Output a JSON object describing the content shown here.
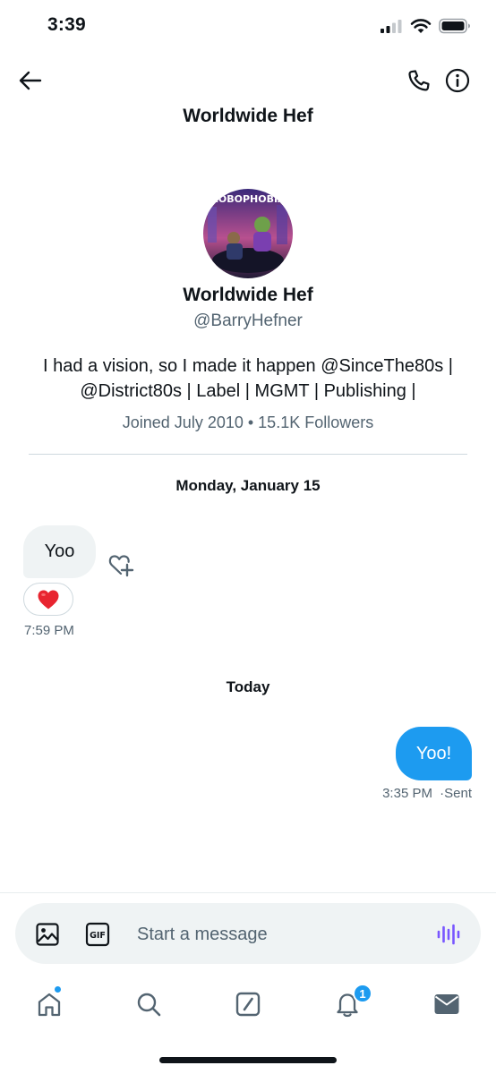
{
  "status_bar": {
    "time": "3:39"
  },
  "header": {
    "title": "Worldwide Hef"
  },
  "profile": {
    "avatar_text": "ROBOPHOBIA",
    "name": "Worldwide Hef",
    "handle": "@BarryHefner",
    "bio_line1": "I had a vision, so I made it happen @SinceThe80s |",
    "bio_line2": "@District80s | Label | MGMT | Publishing |",
    "meta": "Joined July 2010 • 15.1K Followers"
  },
  "conversation": {
    "date_1": "Monday, January 15",
    "received": {
      "text": "Yoo",
      "reaction": "❤️",
      "time": "7:59 PM"
    },
    "date_2": "Today",
    "sent": {
      "text": "Yoo!",
      "time": "3:35 PM",
      "status": "·Sent"
    }
  },
  "composer": {
    "placeholder": "Start a message",
    "gif_label": "GIF"
  },
  "tab_bar": {
    "notifications_badge": "1"
  },
  "colors": {
    "accent": "#1d9bf0",
    "secondary_text": "#536471",
    "bubble_in": "#eff3f4",
    "voice": "#7856ff"
  },
  "icons": [
    "back-arrow-icon",
    "phone-icon",
    "info-icon",
    "heart-plus-icon",
    "image-icon",
    "gif-icon",
    "voice-wave-icon",
    "home-icon",
    "search-icon",
    "spaces-icon",
    "bell-icon",
    "mail-icon"
  ]
}
